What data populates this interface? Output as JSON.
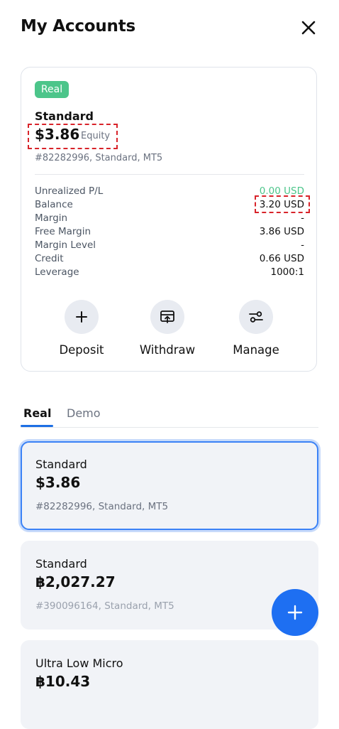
{
  "header": {
    "title": "My Accounts"
  },
  "summary": {
    "badge": "Real",
    "account_name": "Standard",
    "equity_value": "$3.86",
    "equity_label": "Equity",
    "account_desc": "#82282996, Standard, MT5",
    "stats": [
      {
        "label": "Unrealized P/L",
        "value": "0.00 USD"
      },
      {
        "label": "Balance",
        "value": "3.20 USD"
      },
      {
        "label": "Margin",
        "value": "-"
      },
      {
        "label": "Free Margin",
        "value": "3.86 USD"
      },
      {
        "label": "Margin Level",
        "value": "-"
      },
      {
        "label": "Credit",
        "value": "0.66 USD"
      },
      {
        "label": "Leverage",
        "value": "1000:1"
      }
    ],
    "actions": {
      "deposit": "Deposit",
      "withdraw": "Withdraw",
      "manage": "Manage"
    }
  },
  "tabs": {
    "real": "Real",
    "demo": "Demo"
  },
  "accounts": [
    {
      "name": "Standard",
      "balance": "$3.86",
      "desc": "#82282996, Standard, MT5"
    },
    {
      "name": "Standard",
      "balance": "฿2,027.27",
      "desc": "#390096164, Standard, MT5"
    },
    {
      "name": "Ultra Low Micro",
      "balance": "฿10.43",
      "desc": ""
    }
  ],
  "colors": {
    "accent": "#1e6ff2",
    "positive": "#4cc58a",
    "highlight": "#d8232a"
  }
}
